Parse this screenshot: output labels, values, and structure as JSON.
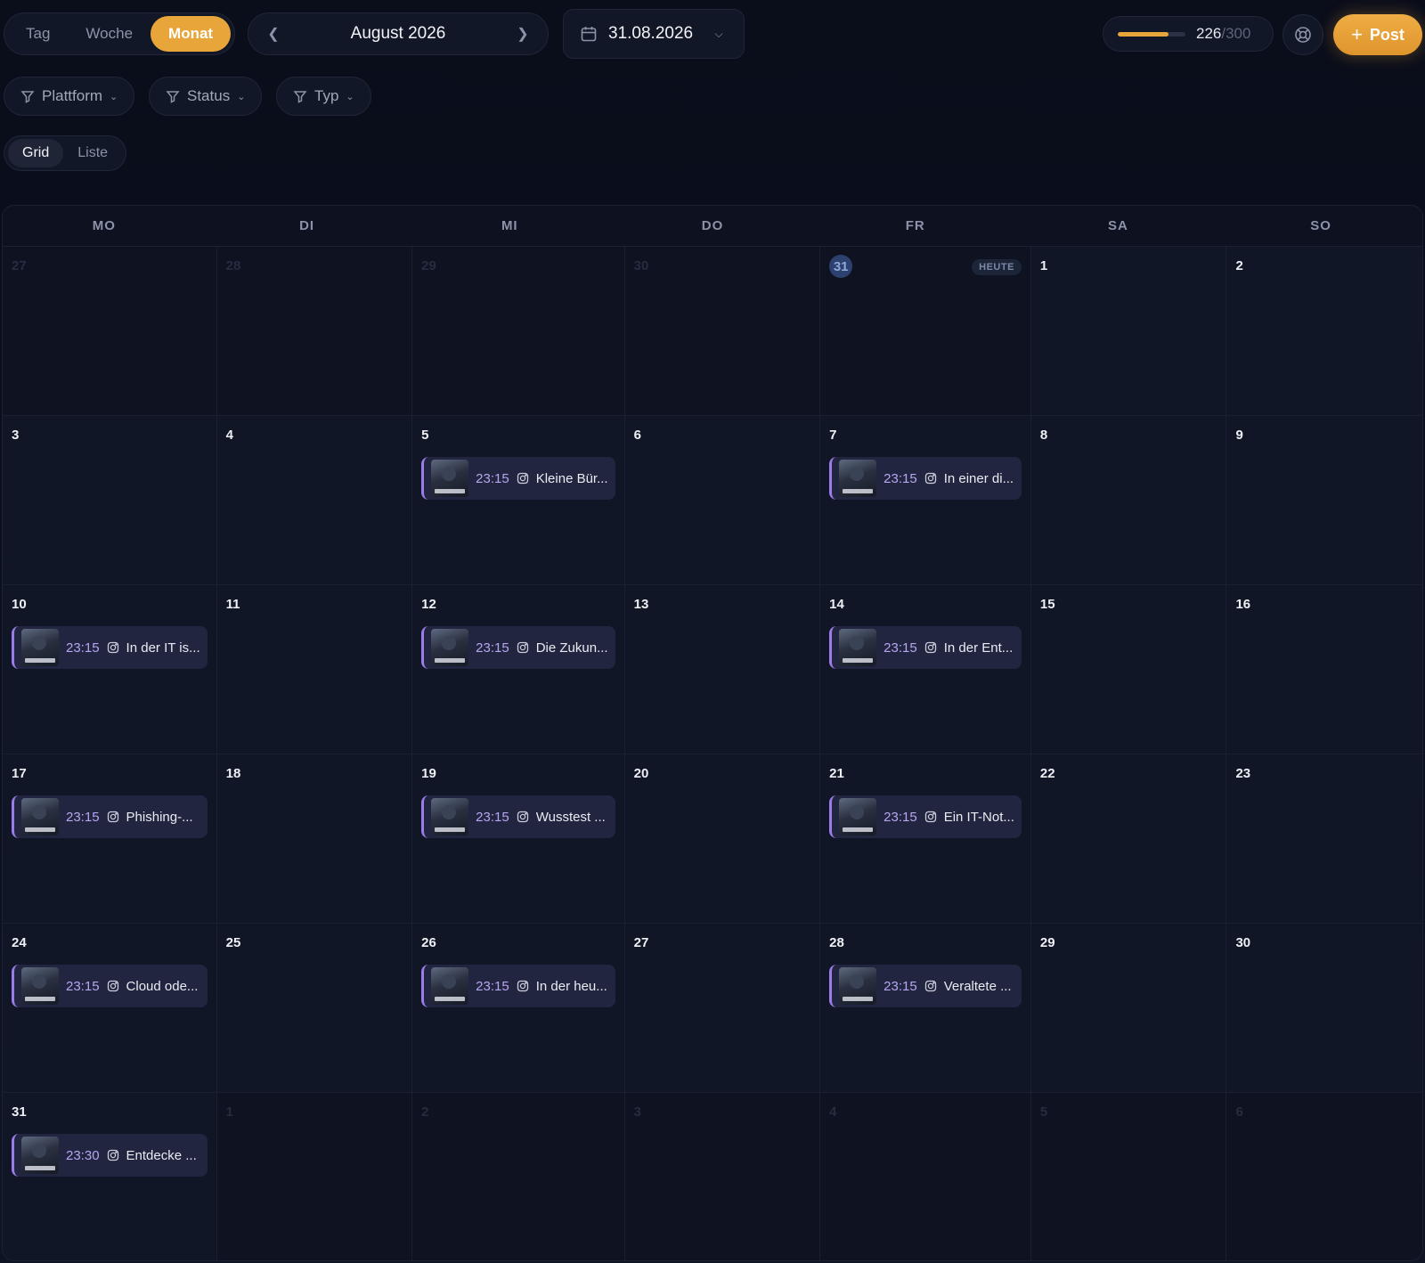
{
  "view_tabs": [
    {
      "label": "Tag",
      "active": false
    },
    {
      "label": "Woche",
      "active": false
    },
    {
      "label": "Monat",
      "active": true
    }
  ],
  "month_nav": {
    "label": "August 2026"
  },
  "date_picker": {
    "value": "31.08.2026"
  },
  "quota": {
    "used": "226",
    "max": "/300",
    "fraction": 0.753
  },
  "post_button": {
    "label": "Post"
  },
  "filters": [
    {
      "label": "Plattform"
    },
    {
      "label": "Status"
    },
    {
      "label": "Typ"
    }
  ],
  "layout_toggle": [
    {
      "label": "Grid",
      "active": true
    },
    {
      "label": "Liste",
      "active": false
    }
  ],
  "weekdays": [
    "MO",
    "DI",
    "MI",
    "DO",
    "FR",
    "SA",
    "SO"
  ],
  "today_badge": "HEUTE",
  "days": [
    {
      "n": "27",
      "out": true
    },
    {
      "n": "28",
      "out": true
    },
    {
      "n": "29",
      "out": true
    },
    {
      "n": "30",
      "out": true
    },
    {
      "n": "31",
      "out": true,
      "today": true
    },
    {
      "n": "1"
    },
    {
      "n": "2"
    },
    {
      "n": "3"
    },
    {
      "n": "4"
    },
    {
      "n": "5",
      "event": {
        "time": "23:15",
        "title": "Kleine Bür..."
      }
    },
    {
      "n": "6"
    },
    {
      "n": "7",
      "event": {
        "time": "23:15",
        "title": "In einer di..."
      }
    },
    {
      "n": "8"
    },
    {
      "n": "9"
    },
    {
      "n": "10",
      "event": {
        "time": "23:15",
        "title": "In der IT is..."
      }
    },
    {
      "n": "11"
    },
    {
      "n": "12",
      "event": {
        "time": "23:15",
        "title": "Die Zukun..."
      }
    },
    {
      "n": "13"
    },
    {
      "n": "14",
      "event": {
        "time": "23:15",
        "title": "In der Ent..."
      }
    },
    {
      "n": "15"
    },
    {
      "n": "16"
    },
    {
      "n": "17",
      "event": {
        "time": "23:15",
        "title": "Phishing-..."
      }
    },
    {
      "n": "18"
    },
    {
      "n": "19",
      "event": {
        "time": "23:15",
        "title": "Wusstest ..."
      }
    },
    {
      "n": "20"
    },
    {
      "n": "21",
      "event": {
        "time": "23:15",
        "title": "Ein IT-Not..."
      }
    },
    {
      "n": "22"
    },
    {
      "n": "23"
    },
    {
      "n": "24",
      "event": {
        "time": "23:15",
        "title": "Cloud ode..."
      }
    },
    {
      "n": "25"
    },
    {
      "n": "26",
      "event": {
        "time": "23:15",
        "title": "In der heu..."
      }
    },
    {
      "n": "27"
    },
    {
      "n": "28",
      "event": {
        "time": "23:15",
        "title": "Veraltete ..."
      }
    },
    {
      "n": "29"
    },
    {
      "n": "30"
    },
    {
      "n": "31",
      "event": {
        "time": "23:30",
        "title": "Entdecke ..."
      }
    },
    {
      "n": "1",
      "out": true
    },
    {
      "n": "2",
      "out": true
    },
    {
      "n": "3",
      "out": true
    },
    {
      "n": "4",
      "out": true
    },
    {
      "n": "5",
      "out": true
    },
    {
      "n": "6",
      "out": true
    }
  ],
  "colors": {
    "accent": "#e8a53a",
    "event_border": "#9b7ce8",
    "event_time": "#b7a6f2"
  }
}
